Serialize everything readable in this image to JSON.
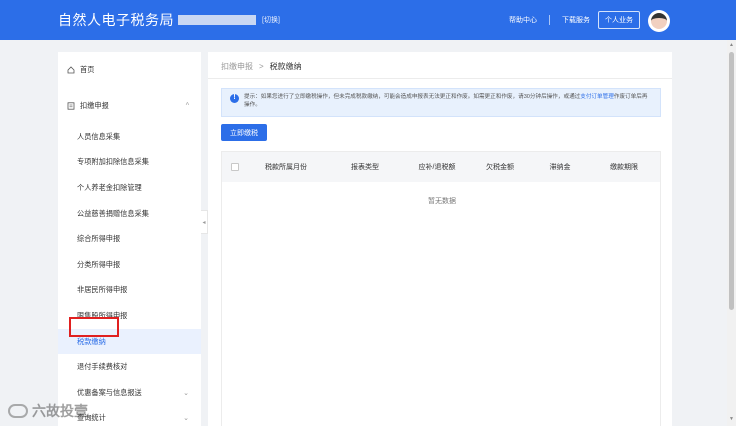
{
  "header": {
    "title": "自然人电子税务局",
    "switch_label": "[切换]",
    "help_label": "帮助中心",
    "download_label": "下载服务",
    "biz_button_label": "个人业务"
  },
  "sidebar": {
    "home_label": "首页",
    "group_label": "扣缴申报",
    "items": [
      {
        "label": "人员信息采集"
      },
      {
        "label": "专项附加扣除信息采集"
      },
      {
        "label": "个人养老金扣除管理"
      },
      {
        "label": "公益慈善捐赠信息采集"
      },
      {
        "label": "综合所得申报"
      },
      {
        "label": "分类所得申报"
      },
      {
        "label": "非居民所得申报"
      },
      {
        "label": "限售股所得申报"
      },
      {
        "label": "税款缴纳"
      },
      {
        "label": "退付手续费核对"
      },
      {
        "label": "优惠备案与信息报送"
      },
      {
        "label": "查询统计"
      }
    ]
  },
  "breadcrumb": {
    "parent": "扣缴申报",
    "separator": ">",
    "current": "税款缴纳"
  },
  "tip": {
    "text": "提示：如果您进行了立即缴税操作，但未完成税款缴纳，可能会造成申报表无法更正和作废。如需更正和作废，请30分钟后操作，或通过",
    "link": "支付订单管理",
    "text2": "作废订单后再操作。"
  },
  "pay_button_label": "立即缴税",
  "table": {
    "columns": [
      "税款所属月份",
      "报表类型",
      "应补/退税额",
      "欠税金额",
      "滞纳金",
      "缴款期限"
    ],
    "empty_text": "暂无数据"
  },
  "watermark": "六故投壹",
  "colors": {
    "primary": "#2c6ee8",
    "highlight_border": "#e02020"
  }
}
